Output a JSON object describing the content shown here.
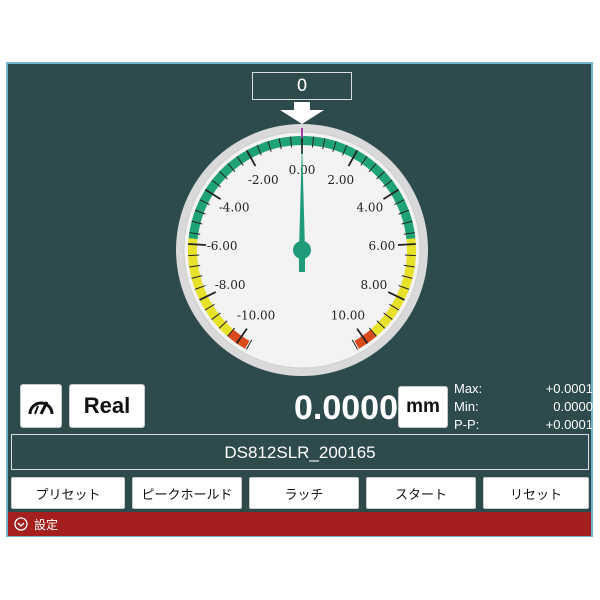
{
  "header": {
    "target_value": "0"
  },
  "gauge": {
    "tick_labels": [
      "-10.00",
      "-8.00",
      "-6.00",
      "-4.00",
      "-2.00",
      "0.00",
      "2.00",
      "4.00",
      "6.00",
      "8.00",
      "10.00"
    ],
    "needle_value": 0.0,
    "colors": {
      "face": "#f2f2f2",
      "green": "#1fa374",
      "yellow": "#e8e12a",
      "red": "#d94a1c",
      "needle": "#1f9b79",
      "zero_marker": "#a03aa6"
    }
  },
  "controls": {
    "speed_icon": "speedometer-icon",
    "mode_label": "Real",
    "value": "0.0000",
    "unit_label": "mm"
  },
  "stats": {
    "max_label": "Max:",
    "max_value": "+0.0001",
    "min_label": "Min:",
    "min_value": "0.0000",
    "pp_label": "P-P:",
    "pp_value": "+0.0001"
  },
  "device_name": "DS812SLR_200165",
  "buttons": {
    "preset": "プリセット",
    "peak_hold": "ピークホールド",
    "latch": "ラッチ",
    "start": "スタート",
    "reset": "リセット"
  },
  "settings": {
    "label": "設定",
    "icon": "chevron-down-circle-icon"
  },
  "theme": {
    "background": "#2d4a4c",
    "border": "#6fb3cc",
    "settings_bar": "#a51f1f"
  }
}
